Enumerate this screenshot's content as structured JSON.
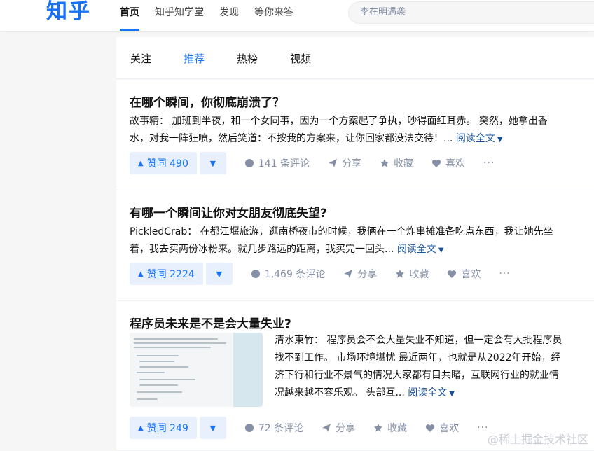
{
  "header": {
    "logo": "知乎",
    "nav": [
      "首页",
      "知乎知学堂",
      "发现",
      "等你来答"
    ],
    "search_placeholder": "李在明遇袭"
  },
  "tabs": [
    "关注",
    "推荐",
    "热榜",
    "视频"
  ],
  "active_tab": "推荐",
  "feed": [
    {
      "title": "在哪个瞬间，你彻底崩溃了？",
      "author": "故事精：",
      "excerpt_line1": "加班到半夜，和一个女同事，因为一个方案起了争执，吵得面红耳赤。 突然，她拿出香",
      "excerpt_line2": "水，对我一阵狂喷，然后笑道：不按我的方案来，让你回家都没法交待！...",
      "read_more": "阅读全文",
      "vote": "赞同 490",
      "comments": "141 条评论",
      "share": "分享",
      "favorite": "收藏",
      "like": "喜欢",
      "more": "···"
    },
    {
      "title": "有哪一个瞬间让你对女朋友彻底失望?",
      "author": "PickledCrab：",
      "excerpt_line1": "在都江堰旅游，逛南桥夜市的时候，我俩在一个炸串摊准备吃点东西，我让她先坐",
      "excerpt_line2": "着，我去买两份冰粉来。就几步路远的距离，我买完一回头...",
      "read_more": "阅读全文",
      "vote": "赞同 2224",
      "comments": "1,469 条评论",
      "share": "分享",
      "favorite": "收藏",
      "like": "喜欢",
      "more": "···"
    },
    {
      "title": "程序员未来是不是会大量失业?",
      "author": "清水東竹：",
      "excerpt_line1": "程序员会不会大量失业不知道，但一定会有大批程序员",
      "excerpt_line2": "找不到工作。 市场环境堪忧 最近两年，也就是从2022年开始，经",
      "excerpt_line3": "济下行和行业不景气的情况大家都有目共睹，互联网行业的就业情",
      "excerpt_line4": "况越来越不容乐观。 头部互...",
      "read_more": "阅读全文",
      "vote": "赞同 249",
      "comments": "72 条评论",
      "share": "分享",
      "favorite": "收藏",
      "like": "喜欢",
      "more": "···"
    }
  ],
  "watermark": "@稀土掘金技术社区",
  "colors": {
    "brand": "#1772f6",
    "link": "#175199",
    "muted": "#8590a6",
    "vote_bg": "#e8f0fe"
  }
}
